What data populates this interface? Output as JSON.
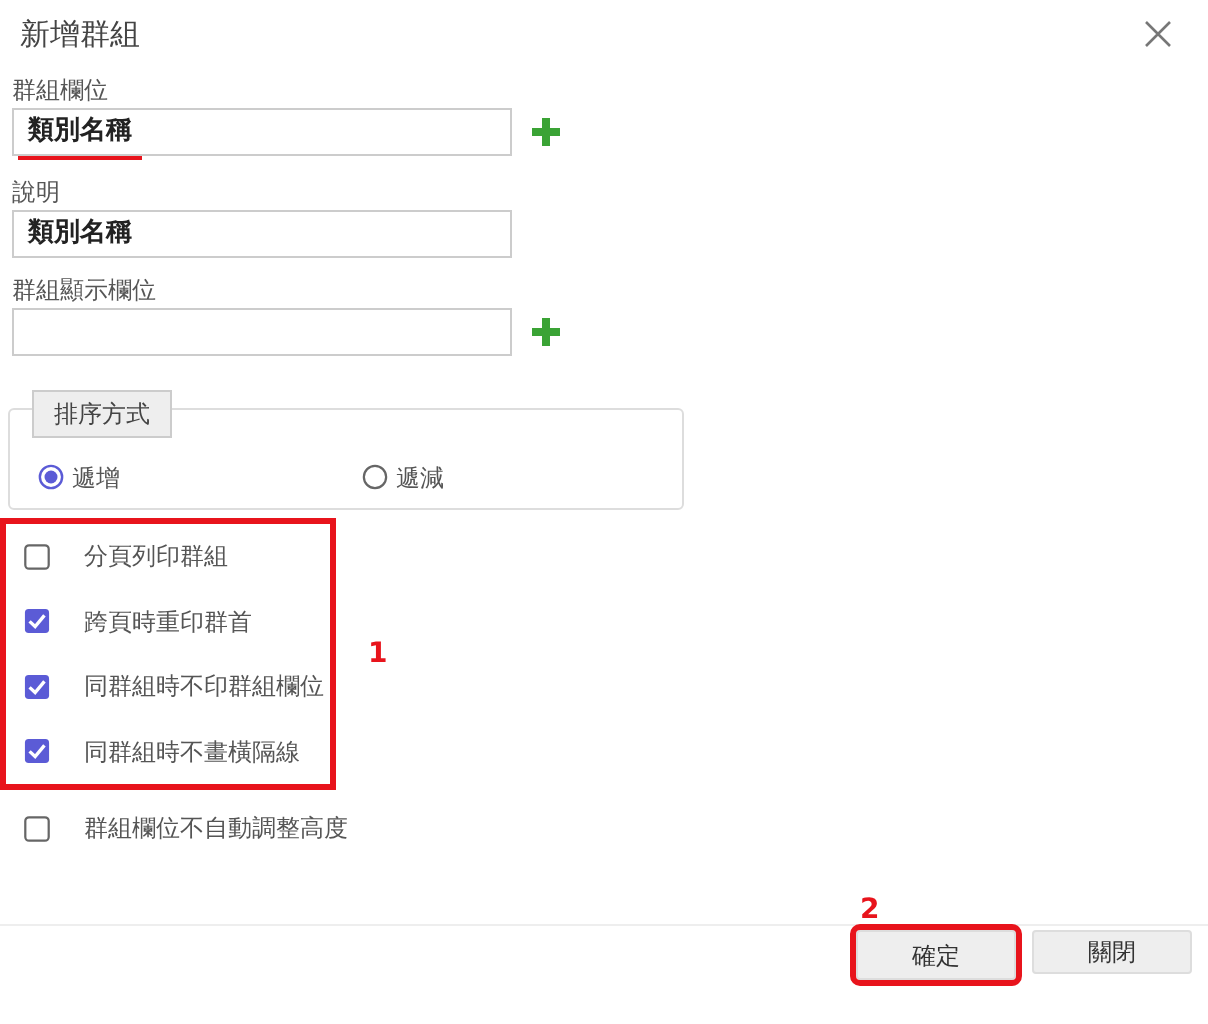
{
  "dialog": {
    "title": "新增群組"
  },
  "fields": [
    {
      "label": "群組欄位",
      "value": "類別名稱",
      "add_button": true,
      "underlined": true
    },
    {
      "label": "說明",
      "value": "類別名稱",
      "add_button": false,
      "underlined": false
    },
    {
      "label": "群組顯示欄位",
      "add_button": true,
      "underlined": false
    }
  ],
  "sort": {
    "legend": "排序方式",
    "options": [
      {
        "label": "遞增",
        "selected": true
      },
      {
        "label": "遞減",
        "selected": false
      }
    ]
  },
  "checkbox_callout": "1",
  "checkboxes": [
    {
      "label": "分頁列印群組",
      "checked": false,
      "highlighted": true
    },
    {
      "label": "跨頁時重印群首",
      "checked": true,
      "highlighted": true
    },
    {
      "label": "同群組時不印群組欄位",
      "checked": true,
      "highlighted": true
    },
    {
      "label": "同群組時不畫橫隔線",
      "checked": true,
      "highlighted": true
    },
    {
      "label": "群組欄位不自動調整高度",
      "checked": false,
      "highlighted": false
    }
  ],
  "buttons": [
    {
      "label": "確定",
      "highlighted": true,
      "callout": "2"
    },
    {
      "label": "關閉",
      "highlighted": false
    }
  ]
}
